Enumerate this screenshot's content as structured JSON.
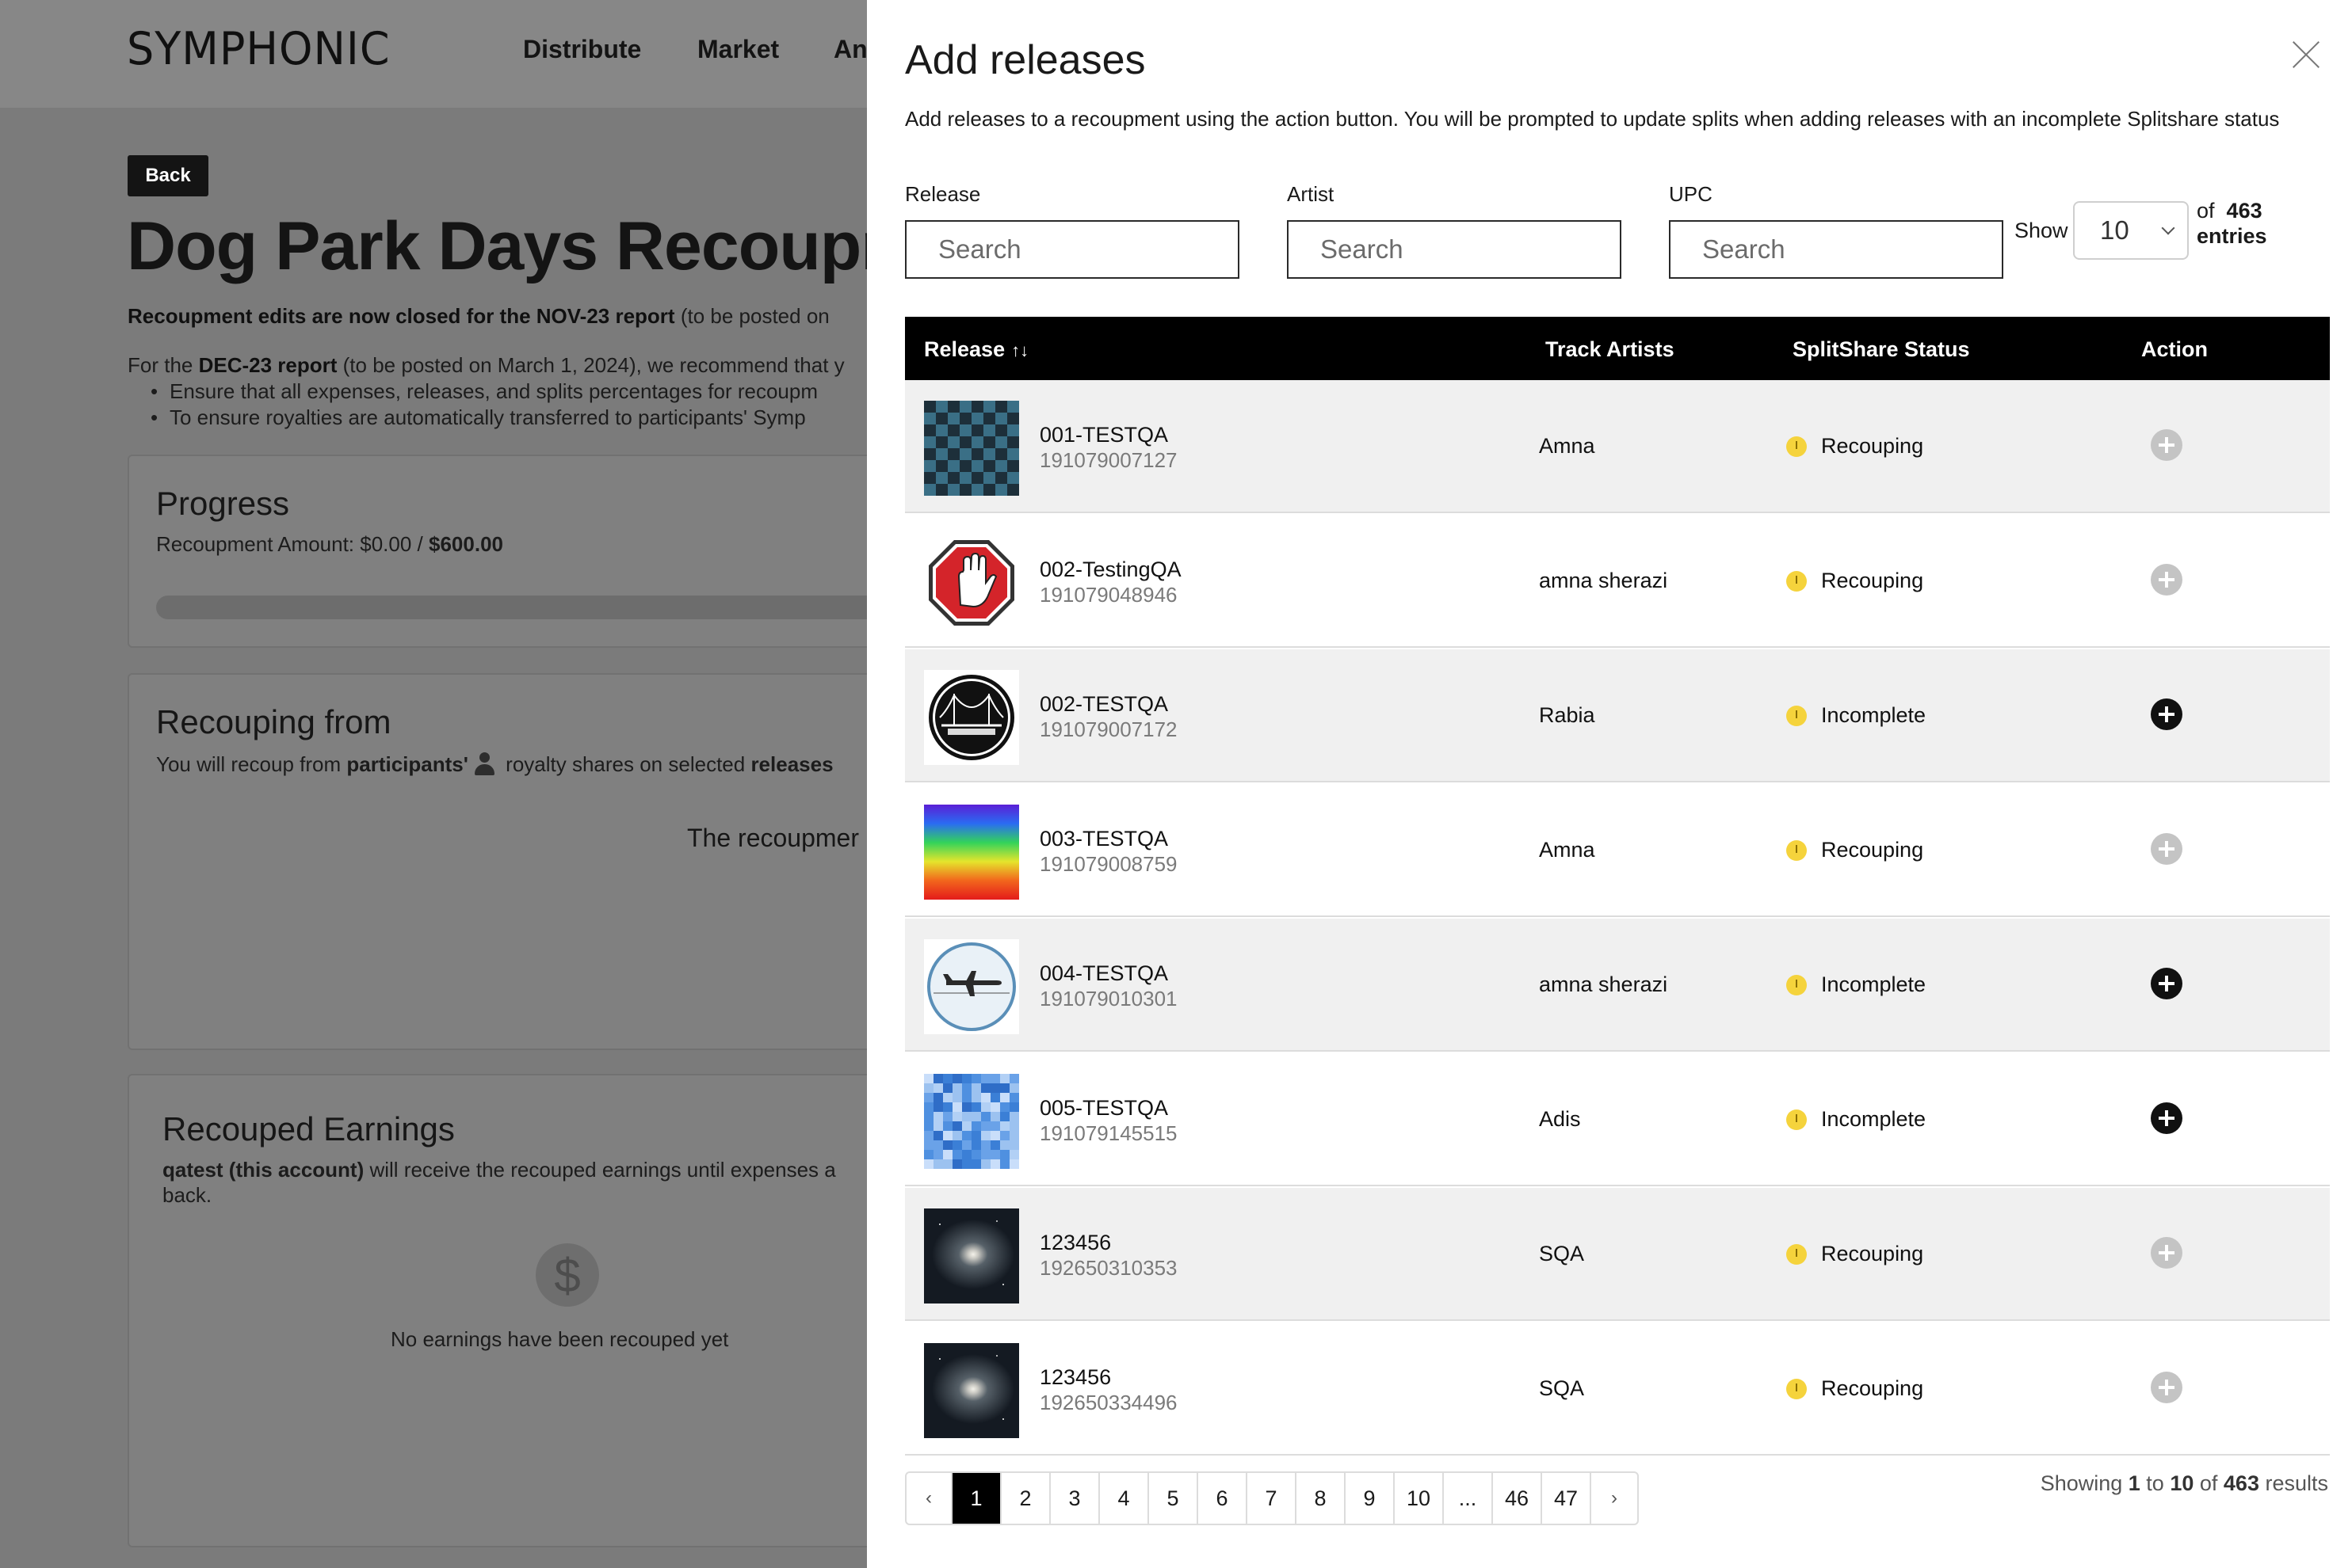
{
  "background": {
    "logo": "SYMPHONIC",
    "nav": [
      "Distribute",
      "Market",
      "An"
    ],
    "back_label": "Back",
    "page_title": "Dog Park Days Recoupm",
    "notice_bold": "Recoupment edits are now closed for the NOV-23 report",
    "notice_rest": " (to be posted on",
    "rec_prefix": "For the ",
    "rec_bold": "DEC-23 report",
    "rec_rest": " (to be posted on March 1, 2024), we recommend that y",
    "bullets": [
      "Ensure that all expenses, releases, and splits percentages for recoupm",
      "To ensure royalties are automatically transferred to participants' Symp"
    ],
    "progress": {
      "title": "Progress",
      "amount_label": "Recoupment Amount: $0.00 / ",
      "amount_total": "$600.00"
    },
    "recouping": {
      "title": "Recouping from",
      "text_prefix": "You will recoup from ",
      "text_bold1": "participants'",
      "text_mid": " royalty shares on selected ",
      "text_bold2": "releases",
      "center_text": "The recoupmer"
    },
    "earnings": {
      "title": "Recouped Earnings",
      "line_bold": "qatest (this account)",
      "line_rest": " will receive the recouped earnings until expenses a",
      "line2": "back.",
      "dollar_icon": "$",
      "empty_text": "No earnings have been recouped yet"
    }
  },
  "modal": {
    "title": "Add releases",
    "description": "Add releases to a recoupment using the action button. You will be prompted to update splits when adding releases with an incomplete Splitshare status",
    "filters": {
      "release_label": "Release",
      "artist_label": "Artist",
      "upc_label": "UPC",
      "placeholder": "Search",
      "show_label": "Show",
      "show_value": "10",
      "of_label": "of",
      "total": "463",
      "entries_label": "entries"
    },
    "columns": {
      "release": "Release",
      "sort_icon": "↑↓",
      "track_artists": "Track Artists",
      "splitshare": "SplitShare Status",
      "action": "Action"
    },
    "rows": [
      {
        "name": "001-TESTQA",
        "upc": "191079007127",
        "artist": "Amna",
        "status": "Recouping",
        "thumb": "checker-teal",
        "action_enabled": false
      },
      {
        "name": "002-TestingQA",
        "upc": "191079048946",
        "artist": "amna sherazi",
        "status": "Recouping",
        "thumb": "stop-hand",
        "action_enabled": false
      },
      {
        "name": "002-TESTQA",
        "upc": "191079007172",
        "artist": "Rabia",
        "status": "Incomplete",
        "thumb": "bosphorus-logo",
        "action_enabled": true
      },
      {
        "name": "003-TESTQA",
        "upc": "191079008759",
        "artist": "Amna",
        "status": "Recouping",
        "thumb": "rainbow-gradient",
        "action_enabled": false
      },
      {
        "name": "004-TESTQA",
        "upc": "191079010301",
        "artist": "amna sherazi",
        "status": "Incomplete",
        "thumb": "airplane-circle",
        "action_enabled": true
      },
      {
        "name": "005-TESTQA",
        "upc": "191079145515",
        "artist": "Adis",
        "status": "Incomplete",
        "thumb": "blue-mosaic",
        "action_enabled": true
      },
      {
        "name": "123456",
        "upc": "192650310353",
        "artist": "SQA",
        "status": "Recouping",
        "thumb": "galaxy",
        "action_enabled": false
      },
      {
        "name": "123456",
        "upc": "192650334496",
        "artist": "SQA",
        "status": "Recouping",
        "thumb": "galaxy",
        "action_enabled": false
      }
    ],
    "pagination": {
      "prev": "‹",
      "pages": [
        "1",
        "2",
        "3",
        "4",
        "5",
        "6",
        "7",
        "8",
        "9",
        "10",
        "...",
        "46",
        "47"
      ],
      "current": "1",
      "next": "›",
      "showing_prefix": "Showing ",
      "from": "1",
      "to_label": " to ",
      "to": "10",
      "of_label": " of ",
      "total": "463",
      "results_label": " results"
    },
    "colors": {
      "header_bg": "#000000",
      "row_alt_bg": "#f0f0f0",
      "status_dot": "#f5d33c",
      "action_enabled": "#111111",
      "action_disabled": "#c4c4c4"
    }
  }
}
